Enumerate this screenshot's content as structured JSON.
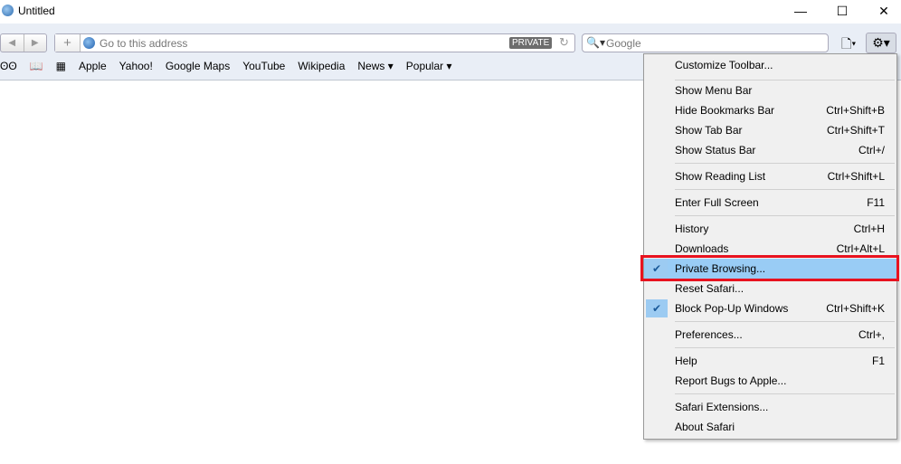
{
  "window": {
    "title": "Untitled",
    "minimize": "—",
    "maximize": "☐",
    "close": "✕"
  },
  "toolbar": {
    "back": "◀",
    "forward": "▶",
    "add": "+",
    "address_placeholder": "Go to this address",
    "private_badge": "PRIVATE",
    "reload": "↻",
    "search_placeholder": "Google",
    "search_icon": "🔍▾",
    "page_icon": "🗋▾",
    "gear_icon": "⚙▾"
  },
  "bookmarks": {
    "reading_list": "ʘʘ",
    "bookmarks_icon": "📖",
    "top_sites": "▦",
    "items": [
      "Apple",
      "Yahoo!",
      "Google Maps",
      "YouTube",
      "Wikipedia",
      "News ▾",
      "Popular ▾"
    ]
  },
  "menu": {
    "items": [
      {
        "label": "Customize Toolbar...",
        "shortcut": ""
      },
      {
        "label": "Show Menu Bar",
        "shortcut": ""
      },
      {
        "label": "Hide Bookmarks Bar",
        "shortcut": "Ctrl+Shift+B"
      },
      {
        "label": "Show Tab Bar",
        "shortcut": "Ctrl+Shift+T"
      },
      {
        "label": "Show Status Bar",
        "shortcut": "Ctrl+/"
      },
      {
        "label": "Show Reading List",
        "shortcut": "Ctrl+Shift+L"
      },
      {
        "label": "Enter Full Screen",
        "shortcut": "F11"
      },
      {
        "label": "History",
        "shortcut": "Ctrl+H"
      },
      {
        "label": "Downloads",
        "shortcut": "Ctrl+Alt+L"
      },
      {
        "label": "Private Browsing...",
        "shortcut": "",
        "checked": true
      },
      {
        "label": "Reset Safari...",
        "shortcut": ""
      },
      {
        "label": "Block Pop-Up Windows",
        "shortcut": "Ctrl+Shift+K",
        "checked": true
      },
      {
        "label": "Preferences...",
        "shortcut": "Ctrl+,"
      },
      {
        "label": "Help",
        "shortcut": "F1"
      },
      {
        "label": "Report Bugs to Apple...",
        "shortcut": ""
      },
      {
        "label": "Safari Extensions...",
        "shortcut": ""
      },
      {
        "label": "About Safari",
        "shortcut": ""
      }
    ],
    "check": "✔"
  }
}
